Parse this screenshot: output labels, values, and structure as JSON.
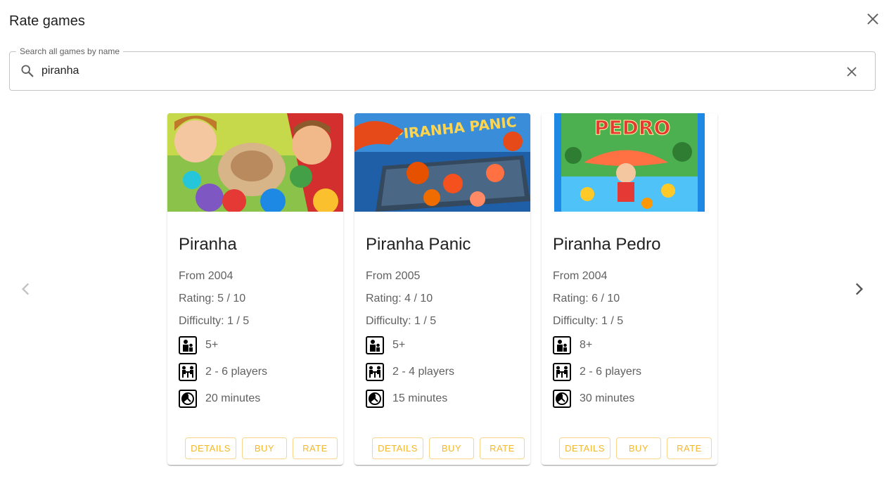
{
  "dialog": {
    "title": "Rate games"
  },
  "search": {
    "label": "Search all games by name",
    "value": "piranha"
  },
  "icons": {
    "close": "close-icon",
    "search": "search-icon",
    "clear": "clear-icon",
    "prev": "chevron-left-icon",
    "next": "chevron-right-icon",
    "age": "age-icon",
    "players": "players-icon",
    "time": "clock-icon"
  },
  "colors": {
    "accent": "#f4b82e",
    "accent_border": "#f8d58a",
    "text_secondary": "#616161"
  },
  "games": [
    {
      "title": "Piranha",
      "year": "From 2004",
      "rating": "Rating: 5 / 10",
      "difficulty": "Difficulty: 1 / 5",
      "age": "5+",
      "players": "2 - 6 players",
      "time": "20 minutes",
      "details_label": "DETAILS",
      "buy_label": "BUY",
      "rate_label": "RATE"
    },
    {
      "title": "Piranha Panic",
      "year": "From 2005",
      "rating": "Rating: 4 / 10",
      "difficulty": "Difficulty: 1 / 5",
      "age": "5+",
      "players": "2 - 4 players",
      "time": "15 minutes",
      "box_text": "PIRANHA PANIC",
      "details_label": "DETAILS",
      "buy_label": "BUY",
      "rate_label": "RATE"
    },
    {
      "title": "Piranha Pedro",
      "year": "From 2004",
      "rating": "Rating: 6 / 10",
      "difficulty": "Difficulty: 1 / 5",
      "age": "8+",
      "players": "2 - 6 players",
      "time": "30 minutes",
      "box_text": "PEDRO",
      "details_label": "DETAILS",
      "buy_label": "BUY",
      "rate_label": "RATE"
    }
  ]
}
